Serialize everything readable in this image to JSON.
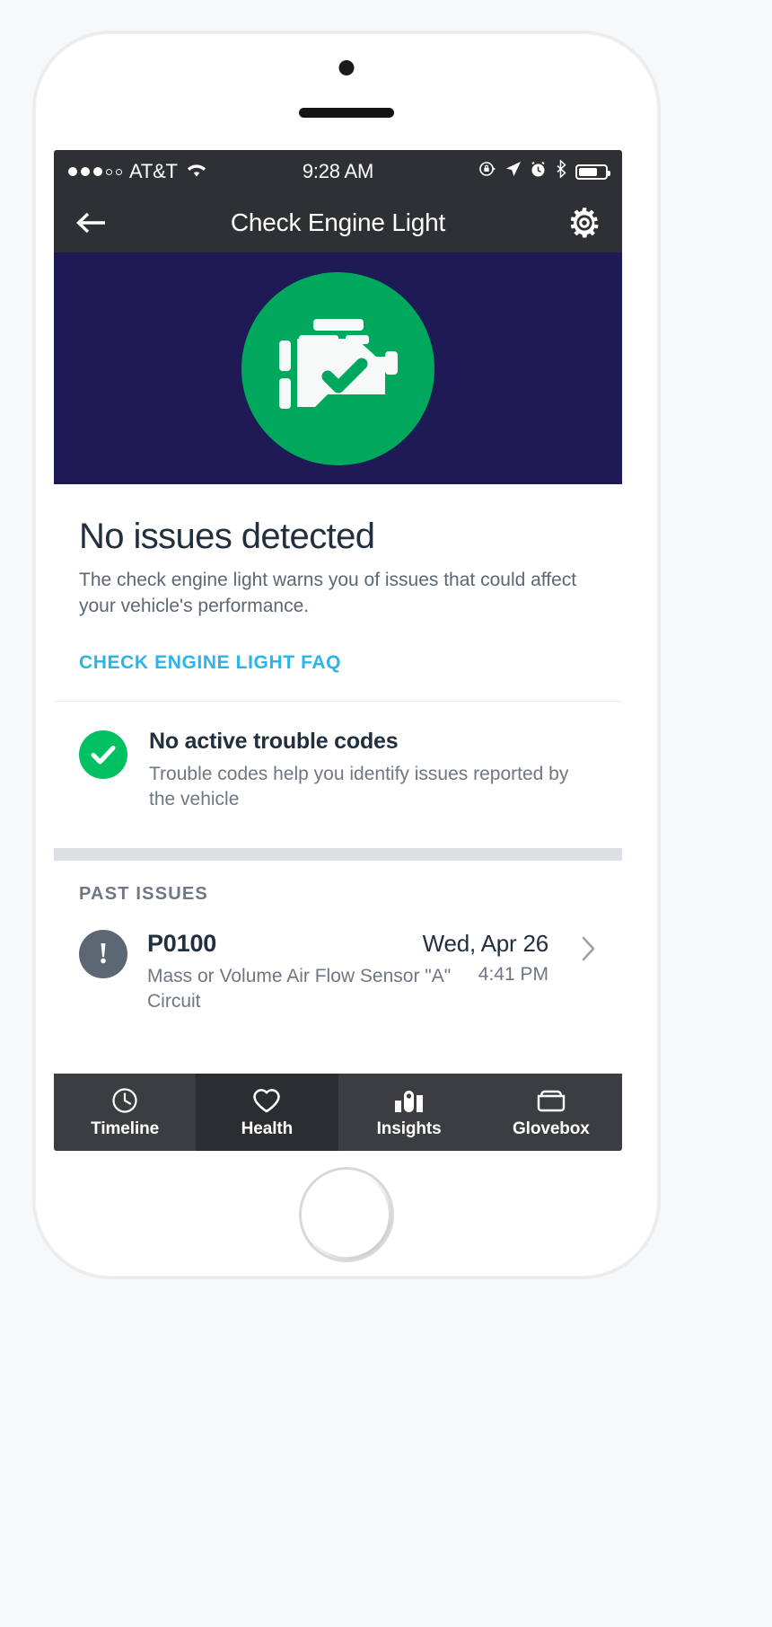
{
  "colors": {
    "navy": "#1E1A55",
    "green": "#00A85D",
    "green_check": "#00C161",
    "link_blue": "#2AB4EA",
    "navbar_dark": "#2F3034",
    "tabbar_dark": "#3C3D41",
    "tabbar_active": "#2C2D30",
    "heading_text": "#212F3F",
    "body_text": "#5D6774"
  },
  "status_bar": {
    "signal_dots_filled": 3,
    "signal_dots_total": 5,
    "carrier": "AT&T",
    "wifi_icon": "wifi-icon",
    "time": "9:28 AM",
    "right_icons": [
      "rotation-lock-icon",
      "location-arrow-icon",
      "alarm-clock-icon",
      "bluetooth-icon"
    ],
    "battery_percent": 62
  },
  "nav_bar": {
    "back_icon": "arrow-left-icon",
    "title": "Check Engine Light",
    "settings_icon": "gear-icon"
  },
  "hero": {
    "badge_icon": "check-engine-check-icon",
    "status": "ok"
  },
  "summary": {
    "title": "No issues detected",
    "body": "The check engine light warns you of issues that could affect your vehicle's performance.",
    "link_label": "CHECK ENGINE LIGHT FAQ"
  },
  "trouble_codes": {
    "icon": "check-circle-icon",
    "title": "No active trouble codes",
    "subtitle": "Trouble codes help you identify issues reported by the vehicle"
  },
  "past_issues": {
    "section_label": "PAST ISSUES",
    "items": [
      {
        "icon": "exclamation-circle-icon",
        "code": "P0100",
        "description": "Mass or Volume Air Flow Sensor \"A\" Circuit",
        "date": "Wed, Apr 26",
        "time": "4:41 PM",
        "chevron": "chevron-right-icon"
      }
    ]
  },
  "tab_bar": {
    "tabs": [
      {
        "label": "Timeline",
        "icon": "clock-icon",
        "active": false
      },
      {
        "label": "Health",
        "icon": "heart-icon",
        "active": true
      },
      {
        "label": "Insights",
        "icon": "bar-chart-icon",
        "active": false
      },
      {
        "label": "Glovebox",
        "icon": "glovebox-icon",
        "active": false
      }
    ]
  }
}
